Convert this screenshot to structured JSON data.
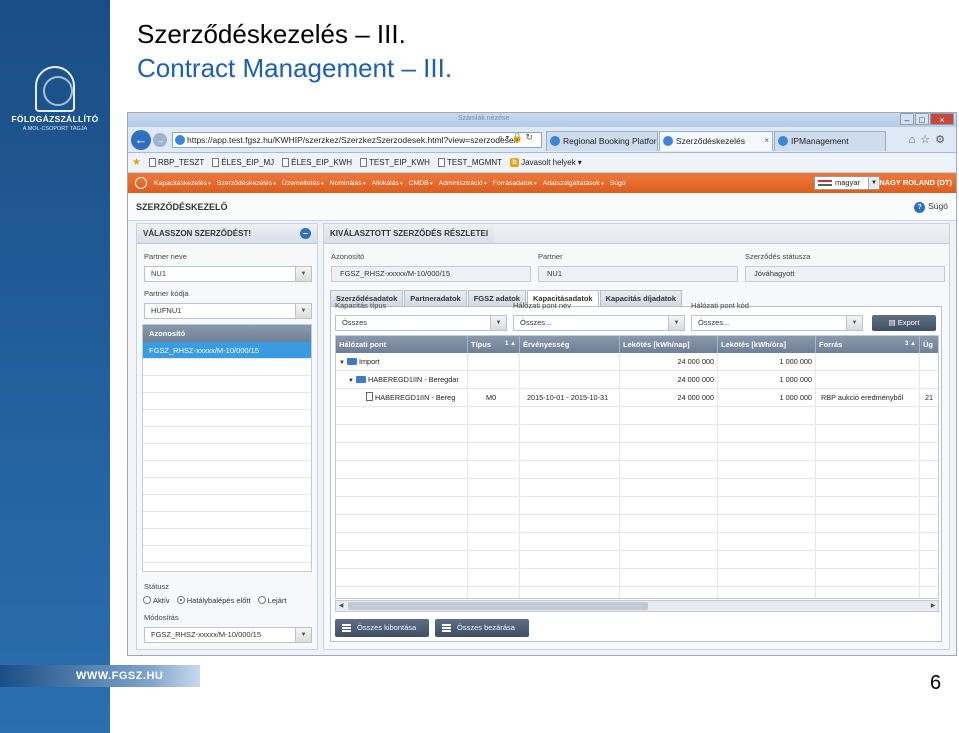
{
  "slide": {
    "title": "Szerződéskezelés – III.",
    "subtitle": "Contract Management – III.",
    "logo_title": "FÖLDGÁZSZÁLLÍTÓ",
    "logo_sub": "A MOL-CSOPORT TAGJA",
    "footer_url": "WWW.FGSZ.HU",
    "page_number": "6"
  },
  "browser": {
    "window_title_faint": "Számlák nézése",
    "address": "https://app.test.fgsz.hu/KWHIP/szerzkez/SzerzkezSzerzodesek.html?view=szerzodesek",
    "address_icons": "⌕ ▾ 🔒 ↻",
    "tabs": [
      {
        "label": "Regional Booking Platform"
      },
      {
        "label": "Szerződéskezelés"
      },
      {
        "label": "IPManagement"
      }
    ],
    "tab_close": "×",
    "favorites": [
      "RBP_TESZT",
      "ÉLES_EIP_MJ",
      "ÉLES_EIP_KWH",
      "TEST_EIP_KWH",
      "TEST_MGMNT",
      "Javasolt helyek"
    ],
    "fav_b_letter": "b"
  },
  "app": {
    "menu": [
      "Kapacitáskezelés",
      "Szerződéskezelés",
      "Üzemeltetés",
      "Nominálás",
      "Allokálás",
      "CMDB",
      "Adminisztráció",
      "Forrásadatok",
      "Adatszolgáltatások",
      "Súgó"
    ],
    "language": "magyar",
    "user": "NAGY ROLAND (DT)",
    "page_title": "SZERZŐDÉSKEZELŐ",
    "help_label": "Súgó"
  },
  "left_panel": {
    "header": "VÁLASSZON SZERZŐDÉST!",
    "partner_name_label": "Partner neve",
    "partner_name_value": "NU1",
    "partner_code_label": "Partner kódja",
    "partner_code_value": "HUFNU1",
    "id_list_header": "Azonosító",
    "id_list_items": [
      "FGSZ_RHSZ-xxxxx/M-10/000/15"
    ],
    "status_label": "Státusz",
    "status_options": [
      "Aktív",
      "Hatálybalépés előtt",
      "Lejárt"
    ],
    "status_selected": "Hatálybalépés előtt",
    "modification_label": "Módosítás",
    "modification_value": "FGSZ_RHSZ-xxxxx/M-10/000/15"
  },
  "right_panel": {
    "header": "KIVÁLASZTOTT SZERZŐDÉS RÉSZLETEI",
    "id_label": "Azonosító",
    "id_value": "FGSZ_RHSZ-xxxxx/M-10/000/15",
    "partner_label": "Partner",
    "partner_value": "NU1",
    "status_label": "Szerződés státusza",
    "status_value": "Jóváhagyott",
    "tabs": [
      "Szerződésadatok",
      "Partneradatok",
      "FGSZ adatok",
      "Kapacitásadatok",
      "Kapacitás díjadatok"
    ],
    "active_tab": "Kapacitásadatok",
    "filters": {
      "capacity_type_label": "Kapacitás típus",
      "capacity_type_value": "Összes",
      "point_name_label": "Hálózati pont név",
      "point_name_value": "Összes...",
      "point_code_label": "Hálózati pont kód",
      "point_code_value": "Összes..."
    },
    "export_label": "Export",
    "grid": {
      "columns": [
        "Hálózati pont",
        "Típus",
        "Érvényesség",
        "Lekötés [kWh/nap]",
        "Lekötés [kWh/óra]",
        "Forrás",
        "Üg"
      ],
      "sort_marks": [
        "1 ▲",
        "3 ▲"
      ],
      "rows": [
        {
          "point": "Import",
          "type": "",
          "validity": "",
          "kwh_day": "24 000 000",
          "kwh_hour": "1 000 000",
          "source": "",
          "ug": ""
        },
        {
          "point": "HABEREGD1IIN - Beregdar",
          "type": "",
          "validity": "",
          "kwh_day": "24 000 000",
          "kwh_hour": "1 000 000",
          "source": "",
          "ug": ""
        },
        {
          "point": "HABEREGD1IIN - Bereg",
          "type": "M0",
          "validity": "2015-10-01 - 2015-10-31",
          "kwh_day": "24 000 000",
          "kwh_hour": "1 000 000",
          "source": "RBP aukció eredményből",
          "ug": "21"
        }
      ]
    },
    "expand_all": "Összes kibontása",
    "collapse_all": "Összes bezárása"
  }
}
